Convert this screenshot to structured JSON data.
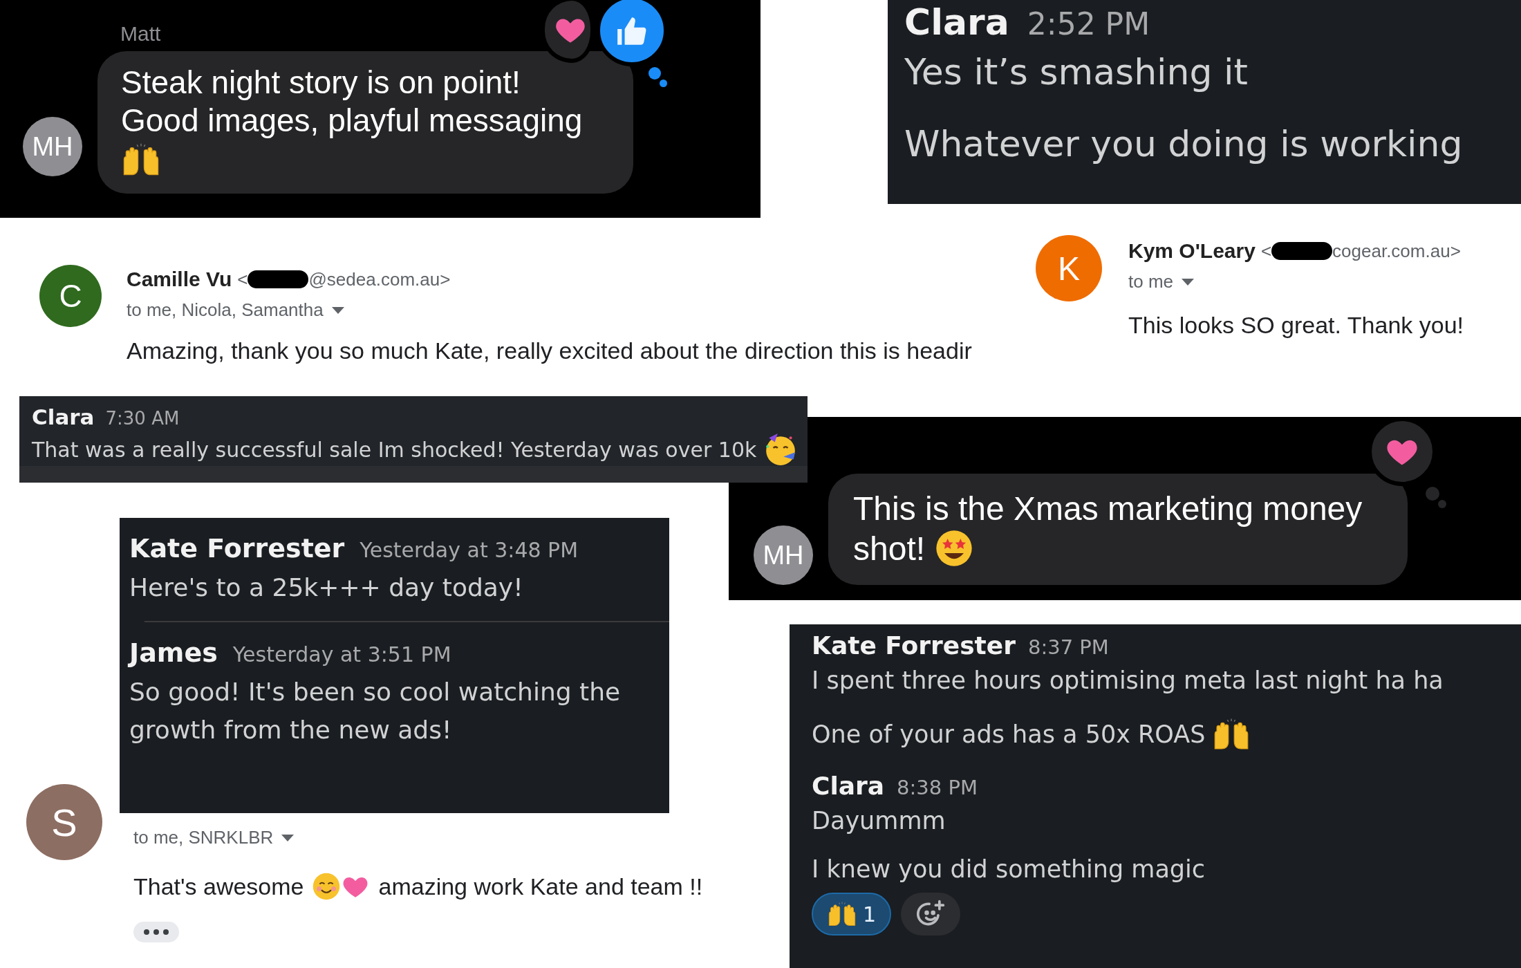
{
  "imessage_top": {
    "sender": "Matt",
    "avatar_initials": "MH",
    "lines": [
      "Steak night story is on point!",
      "Good images, playful messaging"
    ],
    "reactions": [
      {
        "kind": "heart"
      },
      {
        "kind": "thumbs_up"
      }
    ]
  },
  "slack_top": {
    "name": "Clara",
    "time": "2:52 PM",
    "messages": [
      "Yes it’s smashing it",
      "Whatever you doing is working"
    ]
  },
  "email_camille": {
    "avatar_initial": "C",
    "sender": "Camille Vu",
    "address_start": "<",
    "address_end": "@sedea.com.au>",
    "recipients": "to me, Nicola, Samantha",
    "body": "Amazing, thank you so much Kate, really excited about the direction this is headir"
  },
  "email_kym": {
    "avatar_initial": "K",
    "sender": "Kym O'Leary",
    "address_start": "<",
    "address_end": "cogear.com.au>",
    "recipients": "to me",
    "body": "This looks SO great. Thank you!"
  },
  "slack_clara": {
    "name": "Clara",
    "time": "7:30 AM",
    "message": "That was a really successful sale Im shocked! Yesterday was over 10k"
  },
  "imessage_bottom": {
    "avatar_initials": "MH",
    "lines": [
      "This is the Xmas marketing money",
      "shot!"
    ],
    "reactions": [
      {
        "kind": "heart"
      }
    ]
  },
  "slack_thread": {
    "messages": [
      {
        "name": "Kate Forrester",
        "time": "Yesterday at 3:48 PM",
        "lines": [
          "Here's to a 25k+++ day today!"
        ]
      },
      {
        "name": "James",
        "time": "Yesterday at 3:51 PM",
        "lines": [
          "So good! It's been so cool watching the",
          "growth from the new ads!"
        ]
      }
    ]
  },
  "email_reply": {
    "avatar_initial": "S",
    "recipients": "to me, SNRKLBR",
    "body_start": "That's awesome",
    "body_end": "amazing work Kate and team !!"
  },
  "slack_bottom": {
    "messages": [
      {
        "name": "Kate Forrester",
        "time": "8:37 PM",
        "paragraphs": [
          "I spent three hours optimising meta last night ha ha",
          "One of your ads has a 50x ROAS"
        ]
      },
      {
        "name": "Clara",
        "time": "8:38 PM",
        "paragraphs": [
          "Dayummm",
          "I knew you did something magic"
        ]
      }
    ],
    "reactions": [
      {
        "count": "1",
        "selected": true
      }
    ]
  }
}
